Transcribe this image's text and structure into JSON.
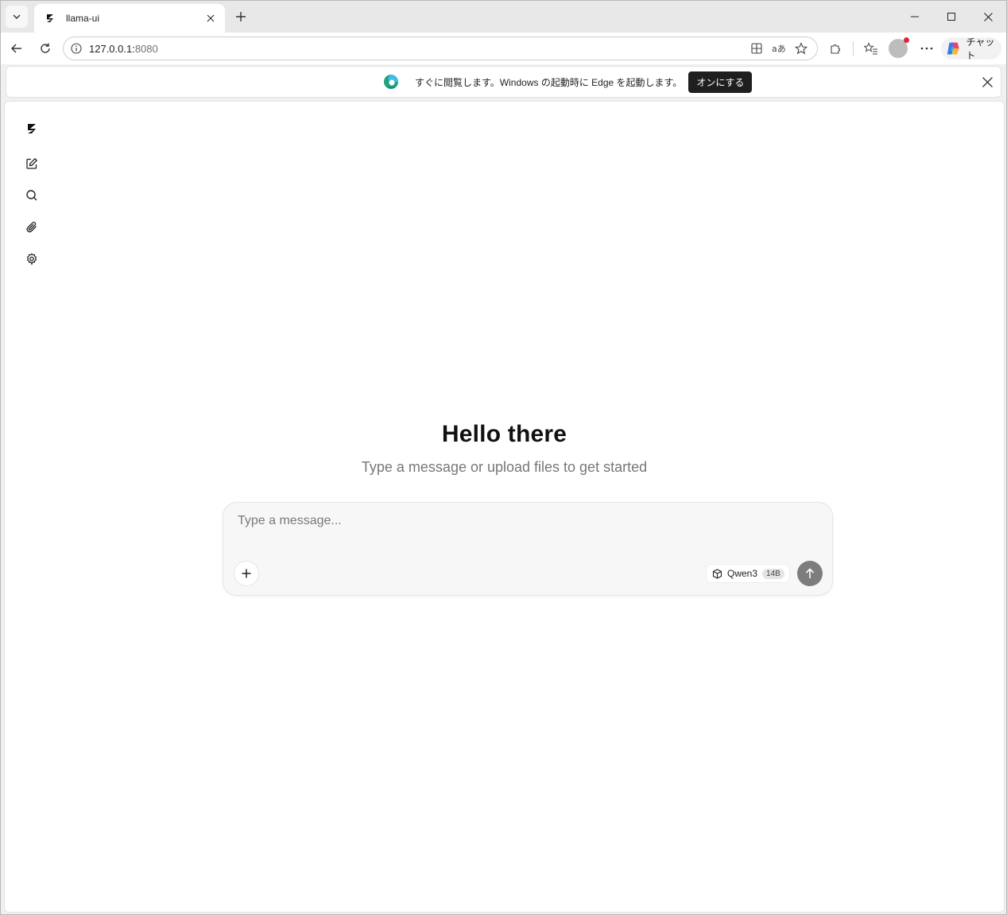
{
  "browser": {
    "tab": {
      "title": "llama-ui"
    },
    "address": {
      "host": "127.0.0.1:",
      "port": "8080"
    },
    "copilot_label": "チャット",
    "infobar": {
      "message": "すぐに閲覧します。Windows の起動時に Edge を起動します。",
      "button_label": "オンにする"
    }
  },
  "app": {
    "sidebar": [
      {
        "name": "logo",
        "icon": "llama-logo-icon"
      },
      {
        "name": "new-chat",
        "icon": "edit-icon"
      },
      {
        "name": "search",
        "icon": "search-icon"
      },
      {
        "name": "attachments",
        "icon": "paperclip-icon"
      },
      {
        "name": "settings",
        "icon": "gear-icon"
      }
    ],
    "hero": {
      "title": "Hello there",
      "subtitle": "Type a message or upload files to get started"
    },
    "composer": {
      "placeholder": "Type a message...",
      "model_name": "Qwen3",
      "model_size": "14B"
    }
  },
  "colors": {
    "send_button": "#7d7d7d",
    "composer_bg": "#f7f7f7",
    "infobar_button": "#1f1f1f"
  }
}
